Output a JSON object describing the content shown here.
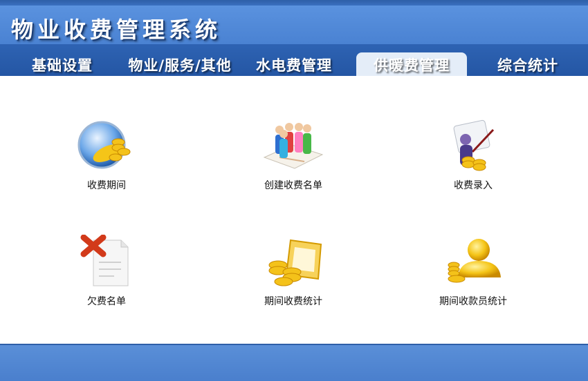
{
  "app_title": "物业收费管理系统",
  "tabs": [
    {
      "label": "基础设置"
    },
    {
      "label": "物业/服务/其他"
    },
    {
      "label": "水电费管理"
    },
    {
      "label": "供暖费管理"
    },
    {
      "label": "综合统计"
    }
  ],
  "active_tab": "供暖费管理",
  "items": [
    {
      "label": "收费期间",
      "icon": "globe-coins-icon"
    },
    {
      "label": "创建收费名单",
      "icon": "people-list-icon"
    },
    {
      "label": "收费录入",
      "icon": "person-coins-icon"
    },
    {
      "label": "欠费名单",
      "icon": "delete-document-icon"
    },
    {
      "label": "期间收费统计",
      "icon": "coins-folder-icon"
    },
    {
      "label": "期间收款员统计",
      "icon": "gold-user-icon"
    }
  ],
  "colors": {
    "header": "#5a92df",
    "tabbar": "#2e63b3",
    "active_tab": "#e4edf8",
    "coin": "#f2b80c"
  }
}
